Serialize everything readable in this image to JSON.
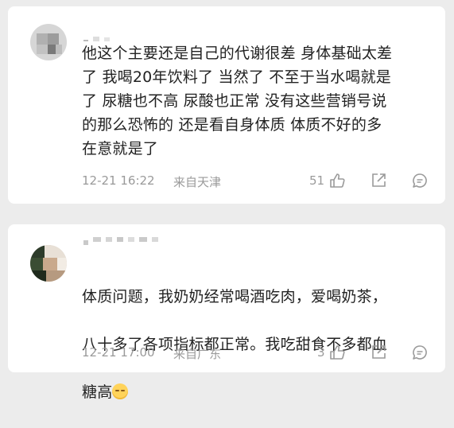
{
  "comments": [
    {
      "content": "他这个主要还是自己的代谢很差 身体基础太差\n了 我喝20年饮料了 当然了 不至于当水喝就是\n了 尿糖也不高 尿酸也正常 没有这些营销号说\n的那么恐怖的 还是看自身体质 体质不好的多\n在意就是了",
      "time": "12-21 16:22",
      "location": "来自天津",
      "like_count": "51",
      "icons": [
        "like-icon",
        "share-icon",
        "comment-icon"
      ]
    },
    {
      "content_lines": [
        "体质问题，我奶奶经常喝酒吃肉，爱喝奶茶，",
        "八十多了各项指标都正常。我吃甜食不多都血",
        "糖高"
      ],
      "emoji": "relieved-face-emoji",
      "time": "12-21 17:00",
      "location": "来自广东",
      "like_count": "3",
      "icons": [
        "like-icon",
        "share-icon",
        "comment-icon"
      ]
    }
  ],
  "colors": {
    "background": "#ececec",
    "card": "#ffffff",
    "text": "#222222",
    "meta": "#9a9a9a"
  }
}
